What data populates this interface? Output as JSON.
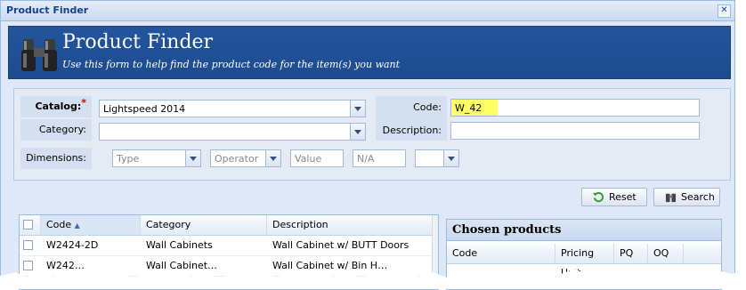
{
  "window": {
    "title": "Product Finder"
  },
  "banner": {
    "title": "Product Finder",
    "subtitle": "Use this form to help find the product code for the item(s) you want"
  },
  "form": {
    "catalog_label": "Catalog:",
    "catalog_value": "Lightspeed 2014",
    "category_label": "Category:",
    "category_value": "",
    "code_label": "Code:",
    "code_value": "W_42",
    "description_label": "Description:",
    "description_value": "",
    "dimensions_label": "Dimensions:",
    "type_placeholder": "Type",
    "operator_placeholder": "Operator",
    "value_placeholder": "Value",
    "na_placeholder": "N/A",
    "unit_value": ""
  },
  "buttons": {
    "reset": "Reset",
    "search": "Search"
  },
  "grid": {
    "columns": [
      "Code",
      "Category",
      "Description"
    ],
    "rows": [
      {
        "code": "W2424-2D",
        "category": "Wall Cabinets",
        "description": "Wall Cabinet w/ BUTT Doors"
      },
      {
        "code": "W242…",
        "category": "Wall Cabinet…",
        "description": "Wall Cabinet w/ Bin H…"
      }
    ]
  },
  "chosen": {
    "title": "Chosen products",
    "columns": [
      "Code",
      "Pricing Unit",
      "PQ",
      "OQ"
    ]
  },
  "colors": {
    "banner": "#23559e",
    "code_highlight": "#ffff66",
    "required": "#cc0000"
  }
}
